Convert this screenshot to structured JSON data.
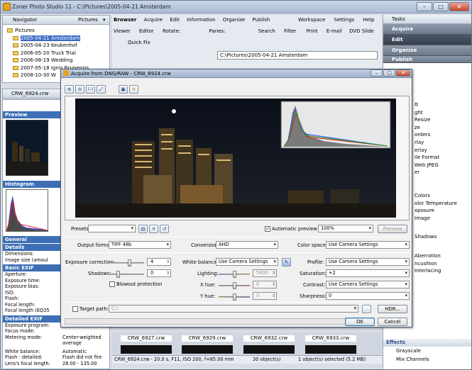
{
  "app": {
    "title": "Zoner Photo Studio 11 - C:\\Pictures\\2005-04-21 Amsterdam",
    "min": "–",
    "max": "□",
    "close": "✕"
  },
  "navigator": {
    "title": "Navigator",
    "pictures_dropdown": "Pictures",
    "root": "Pictures",
    "folders": [
      "2005-04-21 Amsterdam",
      "2005-04-23 Keukenhof",
      "2006-05-20 Truck Trial",
      "2006-08-19 Wedding",
      "2007-05-18 Ignis Brunensis",
      "2008-10-30 W"
    ]
  },
  "menu": {
    "browser_tab": "Browser",
    "items": [
      "Acquire",
      "Edit",
      "Information",
      "Organize",
      "Publish"
    ],
    "workspace": "Workspace",
    "settings": "Settings",
    "help": "Help"
  },
  "toolbar": {
    "viewer": "Viewer",
    "editor": "Editor",
    "rotate": "Rotate:",
    "panes": "Panes:",
    "search": "Search",
    "filter": "Filter",
    "print": "Print",
    "email": "E-mail",
    "dvd": "DVD Slide",
    "quickfix": "Quick Fix",
    "path": "C:\\Pictures\\2005-04-21 Amsterdam"
  },
  "infopane": {
    "file_tab": "CRW_6924.crw",
    "preview": "Preview",
    "histogram": "Histogram",
    "general": "General",
    "details": "Details",
    "dimensions": "Dimensions:",
    "image_size": "Image size (amoul",
    "basic_exif": "Basic EXIF",
    "basic": [
      "Aperture:",
      "Exposure time:",
      "Exposure bias:",
      "ISO:",
      "Flash:",
      "Focal length:",
      "Focal length (EQ35"
    ],
    "detailed_exif": "Detailed EXIF",
    "detailed": [
      {
        "k": "Exposure program:",
        "v": ""
      },
      {
        "k": "Focus mode:",
        "v": ""
      },
      {
        "k": "Metering mode:",
        "v": "Center-weighted"
      },
      {
        "k": "",
        "v": "average"
      },
      {
        "k": "White balance:",
        "v": "Automatic"
      },
      {
        "k": "Flash - detailed:",
        "v": "Flash did not fire"
      },
      {
        "k": "Lens's focal length:",
        "v": "28.00 - 135.00"
      }
    ]
  },
  "tasks": {
    "title": "Tasks",
    "acquire": "Acquire",
    "edit": "Edit",
    "organize": "Organize",
    "publish": "Publish",
    "partial": [
      "ft",
      "ght",
      "Resize",
      "ze",
      "orders",
      "rlay",
      "erlay",
      "ile Format",
      "Web JPEG",
      "er",
      "Colors",
      "olor Temperature",
      "xposure",
      "Image",
      "Shadows",
      "Aberration",
      "ncushion",
      "Interlacing"
    ],
    "effects": "Effects",
    "grayscale": "Grayscale",
    "mix_channels": "Mix Channels"
  },
  "dialog": {
    "title": "Acquire from DNG/RAW - CRW_6924.crw",
    "zoom_buttons": [
      "⊕",
      "⊖",
      "1:1",
      "⤢",
      "▣",
      "☀"
    ],
    "presets_label": "Presets:",
    "presets_value": "",
    "auto_preview_label": "Automatic preview",
    "zoom_value": "100%",
    "preview_btn": "Preview",
    "output_format_label": "Output format:",
    "output_format": "TIFF 48b",
    "conversion_label": "Conversion:",
    "conversion": "AHD",
    "color_space_label": "Color space:",
    "color_space": "Use Camera Settings",
    "exposure_label": "Exposure correction:",
    "exposure_value": "4",
    "shadows_label": "Shadows:",
    "shadows_value": "0",
    "blowout_label": "Blowout protection",
    "wb_label": "White balance:",
    "wb_value": "Use Camera Settings",
    "lighting_label": "Lighting:",
    "lighting_value": "5600",
    "xhue_label": "X hue:",
    "xhue_value": "0",
    "yhue_label": "Y hue:",
    "yhue_value": "0",
    "profile_label": "Profile:",
    "profile_value": "Use Camera Settings",
    "saturation_label": "Saturation:",
    "saturation_value": "+2",
    "contrast_label": "Contrast:",
    "contrast_value": "Use Camera Settings",
    "sharpness_label": "Sharpness:",
    "sharpness_value": "0",
    "target_label": "Target path:",
    "target_value": "C:\\",
    "hdr_btn": "HDR...",
    "ok_btn": "OK",
    "cancel_btn": "Cancel"
  },
  "filmstrip": {
    "thumbs": [
      "CRW_6927.crw",
      "CRW_6929.crw",
      "CRW_6932.crw",
      "CRW_6933.crw"
    ]
  },
  "status": {
    "info": "CRW_6924.crw - 20.0 s, F11, ISO 200, f=85.00 mm",
    "count": "30 object(s)",
    "selected": "1 object(s) selected (5.2 MB)"
  }
}
